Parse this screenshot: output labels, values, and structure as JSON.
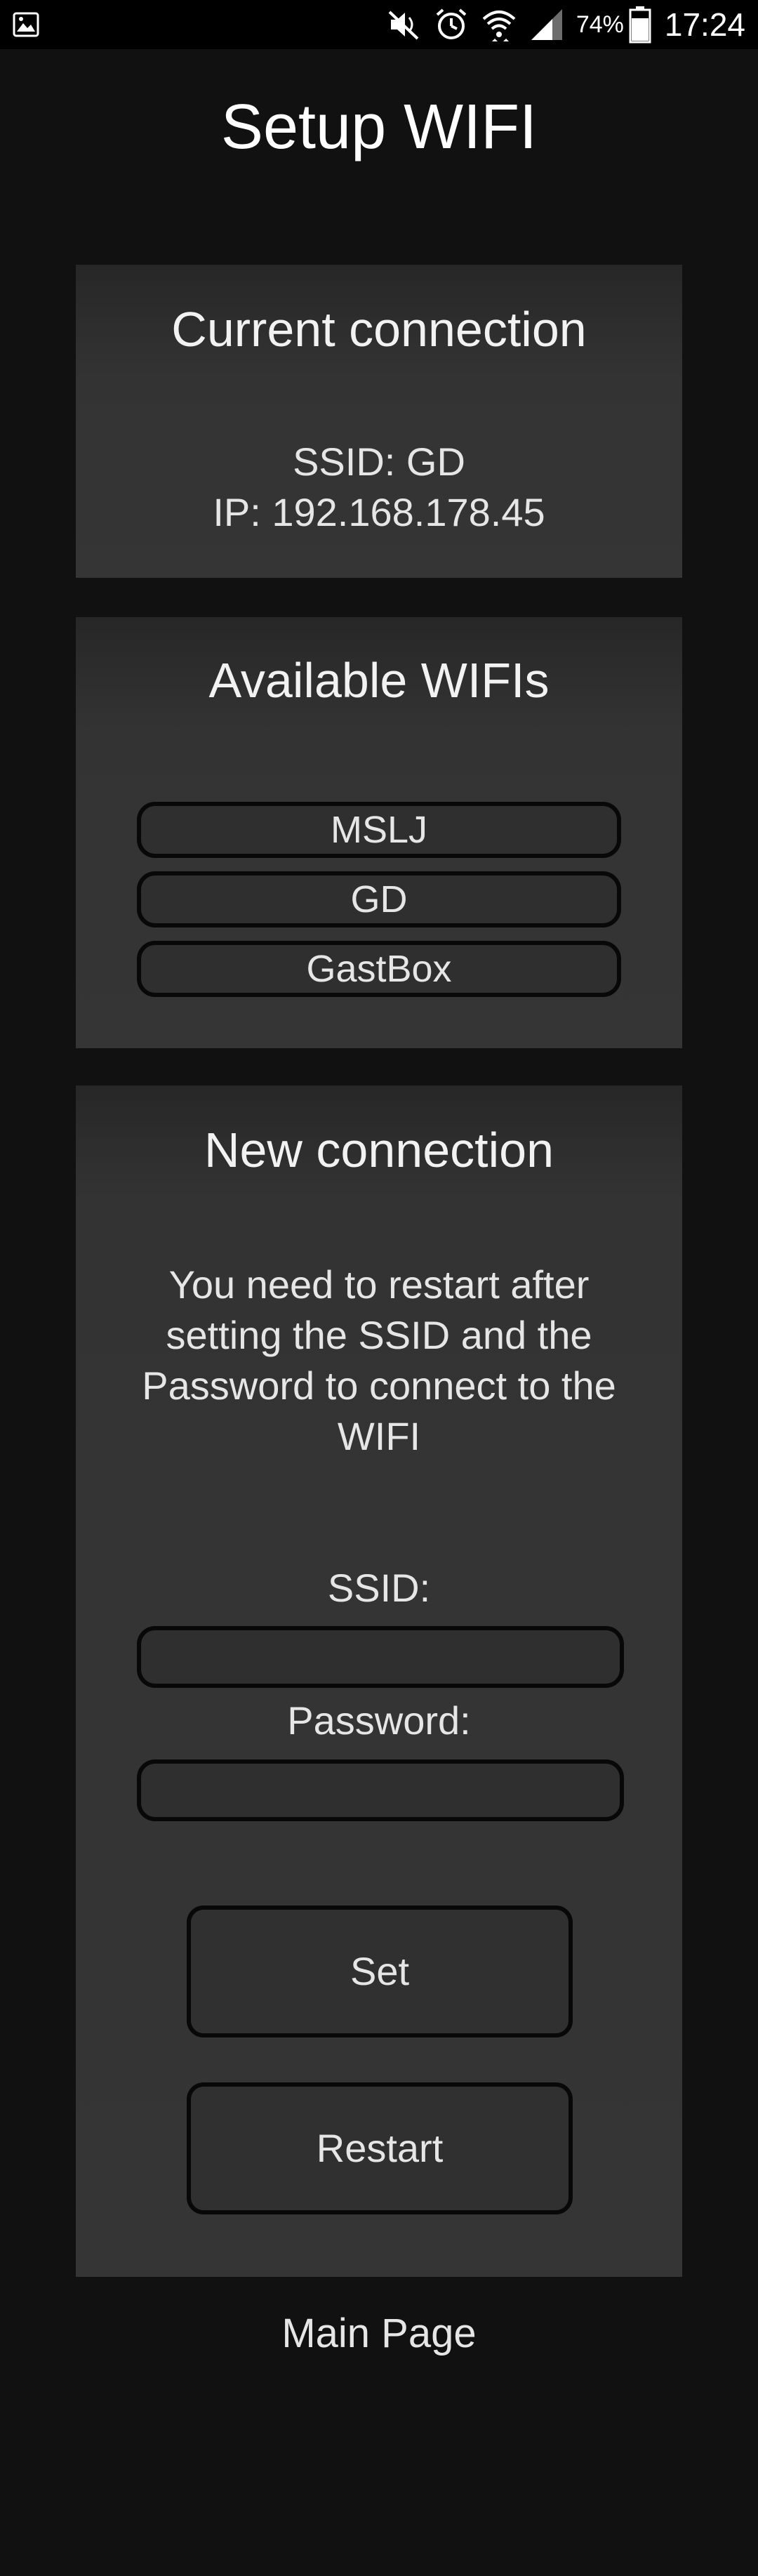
{
  "status_bar": {
    "icons": [
      "gallery-icon",
      "mute-icon",
      "alarm-icon",
      "wifi-icon",
      "signal-icon",
      "battery-icon"
    ],
    "battery": "74%",
    "time": "17:24"
  },
  "page_title": "Setup WIFI",
  "current_connection": {
    "title": "Current connection",
    "ssid_line": "SSID: GD",
    "ip_line": "IP: 192.168.178.45"
  },
  "available_wifis": {
    "title": "Available WIFIs",
    "networks": [
      "MSLJ",
      "GD",
      "GastBox"
    ]
  },
  "new_connection": {
    "title": "New connection",
    "info": "You need to restart after setting the SSID and the Password to connect to the WIFI",
    "ssid_label": "SSID:",
    "ssid_value": "",
    "password_label": "Password:",
    "password_value": "",
    "set_label": "Set",
    "restart_label": "Restart"
  },
  "main_page_link": "Main Page"
}
